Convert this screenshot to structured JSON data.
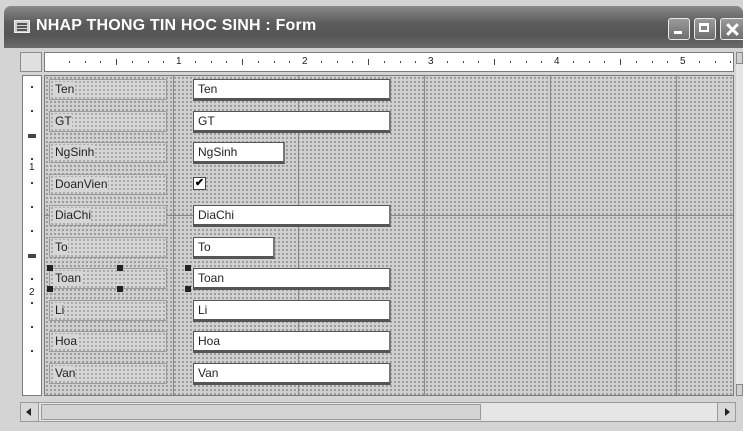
{
  "window": {
    "title": "NHAP THONG TIN HOC SINH : Form"
  },
  "ruler": {
    "h_numbers": [
      "1",
      "2",
      "3",
      "4",
      "5"
    ],
    "v_numbers": [
      "1",
      "2"
    ]
  },
  "fields": [
    {
      "label": "Ten",
      "value": "Ten"
    },
    {
      "label": "GT",
      "value": "GT"
    },
    {
      "label": "NgSinh",
      "value": "NgSinh"
    },
    {
      "label": "DoanVien",
      "checked": true
    },
    {
      "label": "DiaChi",
      "value": "DiaChi"
    },
    {
      "label": "To",
      "value": "To"
    },
    {
      "label": "Toan",
      "value": "Toan",
      "selected": true
    },
    {
      "label": "Li",
      "value": "Li"
    },
    {
      "label": "Hoa",
      "value": "Hoa"
    },
    {
      "label": "Van",
      "value": "Van"
    }
  ],
  "icons": {
    "app": "form-icon",
    "minimize": "minimize-icon",
    "maximize": "maximize-icon",
    "close": "close-icon",
    "checkbox": "checkmark-icon",
    "scroll_left": "arrow-left-icon",
    "scroll_right": "arrow-right-icon"
  }
}
